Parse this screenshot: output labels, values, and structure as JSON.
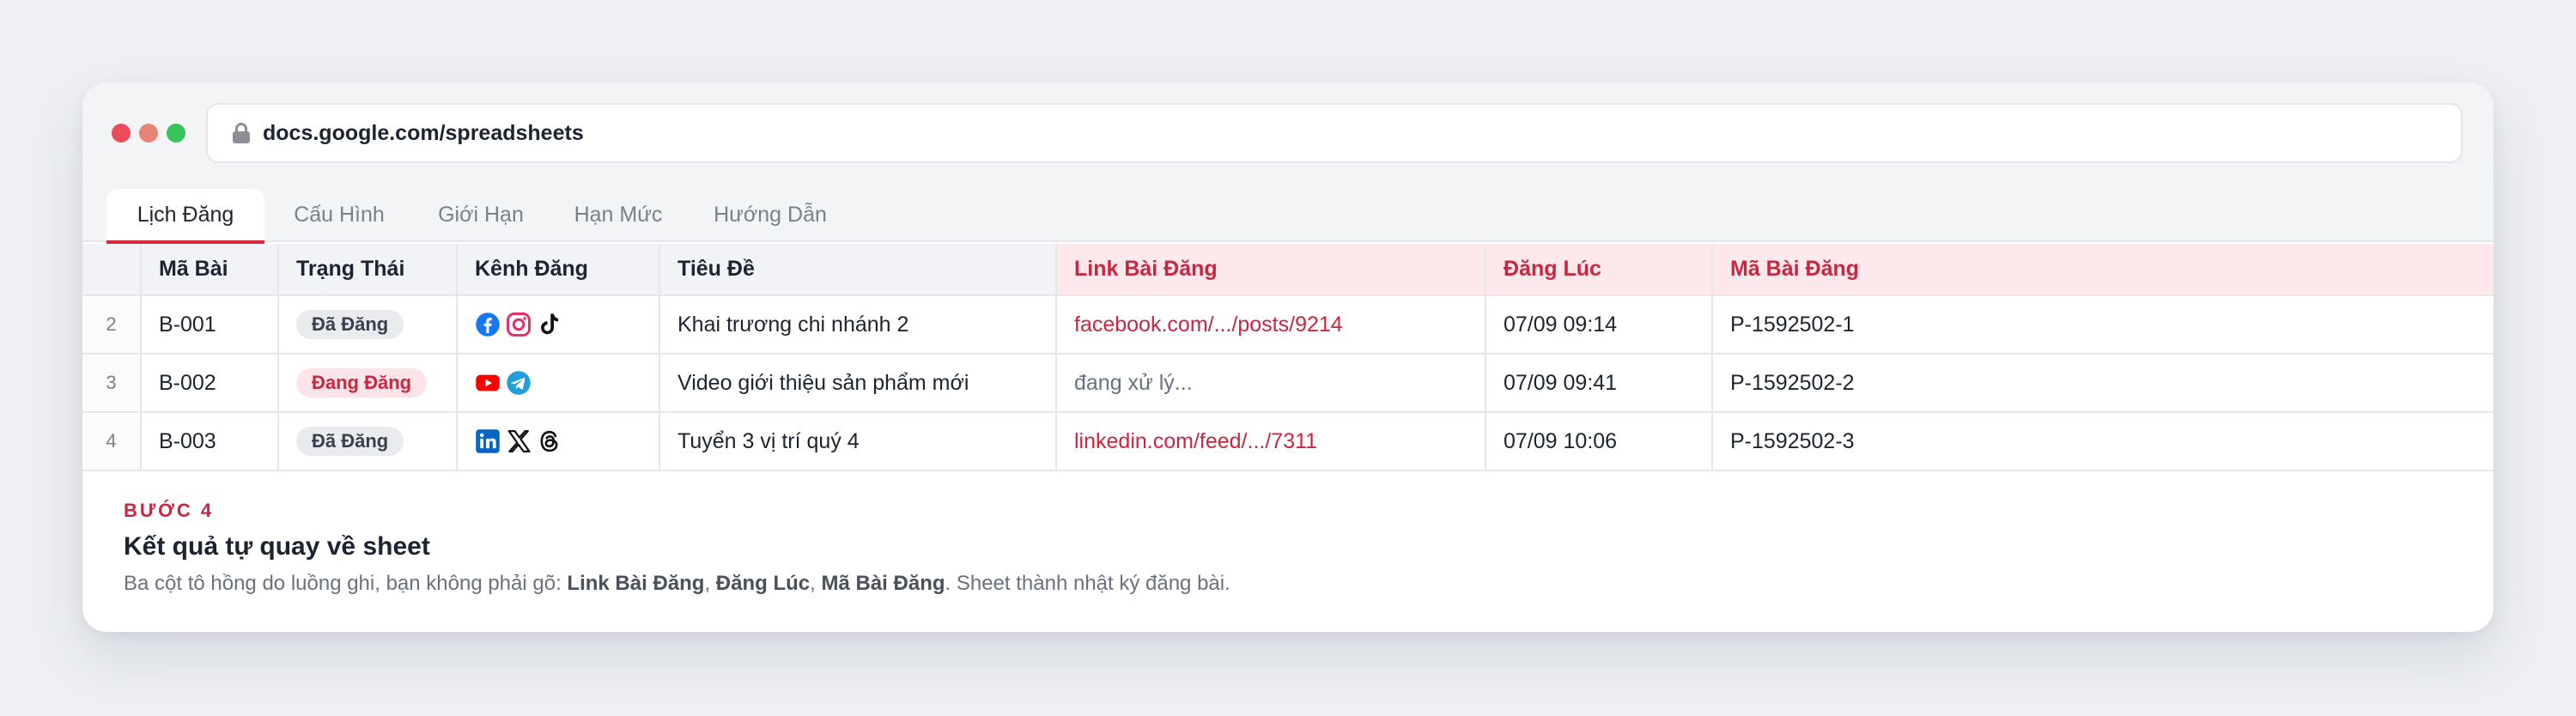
{
  "browser": {
    "url": "docs.google.com/spreadsheets"
  },
  "tabs": [
    {
      "label": "Lịch Đăng",
      "active": true
    },
    {
      "label": "Cấu Hình"
    },
    {
      "label": "Giới Hạn"
    },
    {
      "label": "Hạn Mức"
    },
    {
      "label": "Hướng Dẫn"
    }
  ],
  "table": {
    "headers": {
      "code": "Mã Bài",
      "status": "Trạng Thái",
      "channel": "Kênh Đăng",
      "title": "Tiêu Đề",
      "link": "Link Bài Đăng",
      "posted_at": "Đăng Lúc",
      "post_id": "Mã Bài Đăng"
    },
    "highlight_color": "#c72741",
    "rows": [
      {
        "num": "2",
        "code": "B-001",
        "status": "Đã Đăng",
        "status_type": "done",
        "channels": [
          "facebook-icon",
          "instagram-icon",
          "tiktok-icon"
        ],
        "title": "Khai trương chi nhánh 2",
        "link": "facebook.com/.../posts/9214",
        "posted_at": "07/09 09:14",
        "post_id": "P-1592502-1"
      },
      {
        "num": "3",
        "code": "B-002",
        "status": "Đang Đăng",
        "status_type": "pending",
        "channels": [
          "youtube-icon",
          "telegram-icon"
        ],
        "title": "Video giới thiệu sản phẩm mới",
        "link": "đang xử lý...",
        "posted_at": "07/09 09:41",
        "post_id": "P-1592502-2"
      },
      {
        "num": "4",
        "code": "B-003",
        "status": "Đã Đăng",
        "status_type": "done",
        "channels": [
          "linkedin-icon",
          "x-icon",
          "threads-icon"
        ],
        "title": "Tuyển 3 vị trí quý 4",
        "link": "linkedin.com/feed/.../7311",
        "posted_at": "07/09 10:06",
        "post_id": "P-1592502-3"
      }
    ]
  },
  "footer": {
    "step": "BƯỚC 4",
    "title": "Kết quả tự quay về sheet",
    "desc_prefix": "Ba cột tô hồng do luồng ghi, bạn không phải gõ: ",
    "col1": "Link Bài Đăng",
    "sep1": ", ",
    "col2": "Đăng Lúc",
    "sep2": ", ",
    "col3": "Mã Bài Đăng",
    "desc_suffix": ". Sheet thành nhật ký đăng bài."
  }
}
